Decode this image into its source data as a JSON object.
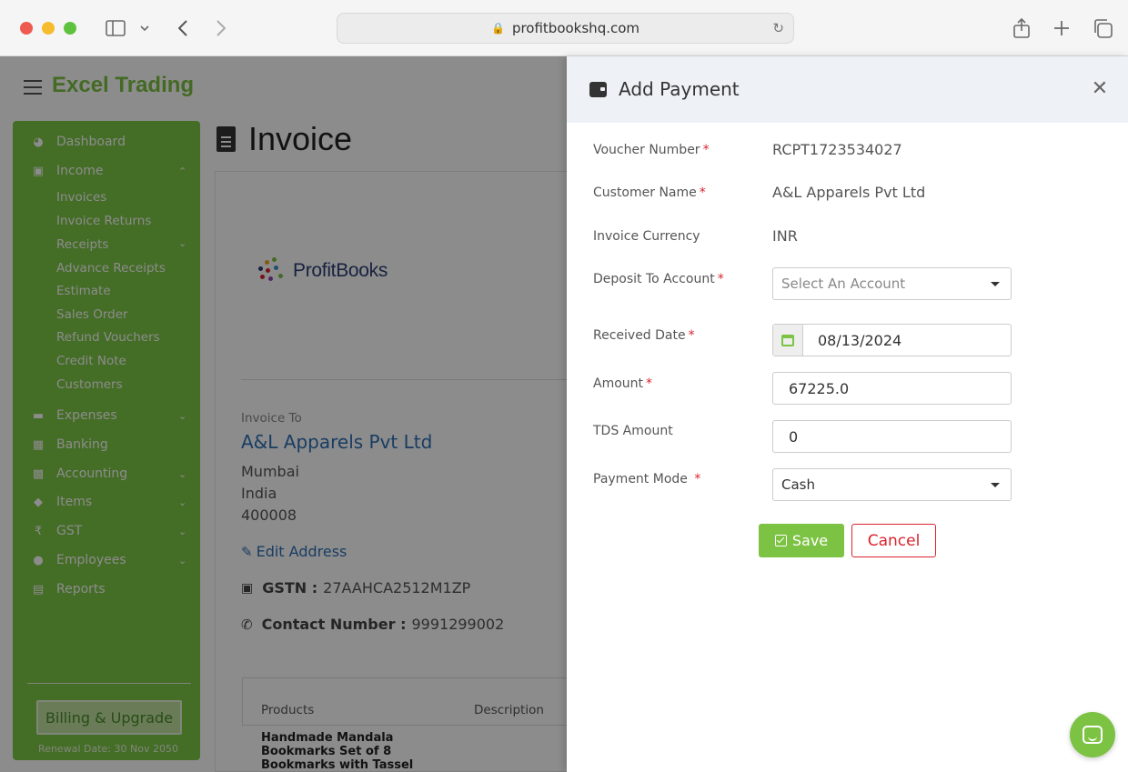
{
  "browser": {
    "url": "profitbookshq.com"
  },
  "app": {
    "brand": "Excel Trading",
    "brand_color": "#7cc243"
  },
  "sidebar": {
    "items": [
      {
        "label": "Dashboard",
        "icon": "pie-chart-icon"
      },
      {
        "label": "Income",
        "icon": "money-icon",
        "expanded": true
      },
      {
        "label": "Expenses",
        "icon": "card-icon"
      },
      {
        "label": "Banking",
        "icon": "bank-icon"
      },
      {
        "label": "Accounting",
        "icon": "book-icon"
      },
      {
        "label": "Items",
        "icon": "tag-icon"
      },
      {
        "label": "GST",
        "icon": "rupee-icon"
      },
      {
        "label": "Employees",
        "icon": "users-icon"
      },
      {
        "label": "Reports",
        "icon": "bar-chart-icon"
      }
    ],
    "income_sub": [
      "Invoices",
      "Invoice Returns",
      "Receipts",
      "Advance Receipts",
      "Estimate",
      "Sales Order",
      "Refund Vouchers",
      "Credit Note",
      "Customers"
    ],
    "billing_label": "Billing & Upgrade",
    "renewal": "Renewal Date: 30 Nov 2050"
  },
  "page": {
    "title": "Invoice",
    "logo_text": "ProfitBooks",
    "invoice_to_label": "Invoice To",
    "customer": "A&L Apparels Pvt Ltd",
    "address": [
      "Mumbai",
      "India",
      "400008"
    ],
    "edit_address": "Edit Address",
    "gstn_label": "GSTN :",
    "gstn_value": "27AAHCA2512M1ZP",
    "contact_label": "Contact Number :",
    "contact_value": "9991299002",
    "table_headers": [
      "Products",
      "Description"
    ],
    "first_product": "Handmade Mandala Bookmarks Set of 8 Bookmarks with Tassel"
  },
  "modal": {
    "title": "Add Payment",
    "fields": {
      "voucher_label": "Voucher Number",
      "voucher_value": "RCPT1723534027",
      "customer_label": "Customer Name",
      "customer_value": "A&L Apparels Pvt Ltd",
      "currency_label": "Invoice Currency",
      "currency_value": "INR",
      "deposit_label": "Deposit To Account",
      "deposit_placeholder": "Select An Account",
      "date_label": "Received Date",
      "date_value": "08/13/2024",
      "amount_label": "Amount",
      "amount_value": "67225.0",
      "tds_label": "TDS Amount",
      "tds_value": "0",
      "mode_label": "Payment Mode",
      "mode_value": "Cash"
    },
    "required_mark": "*",
    "save_label": "Save",
    "cancel_label": "Cancel"
  }
}
